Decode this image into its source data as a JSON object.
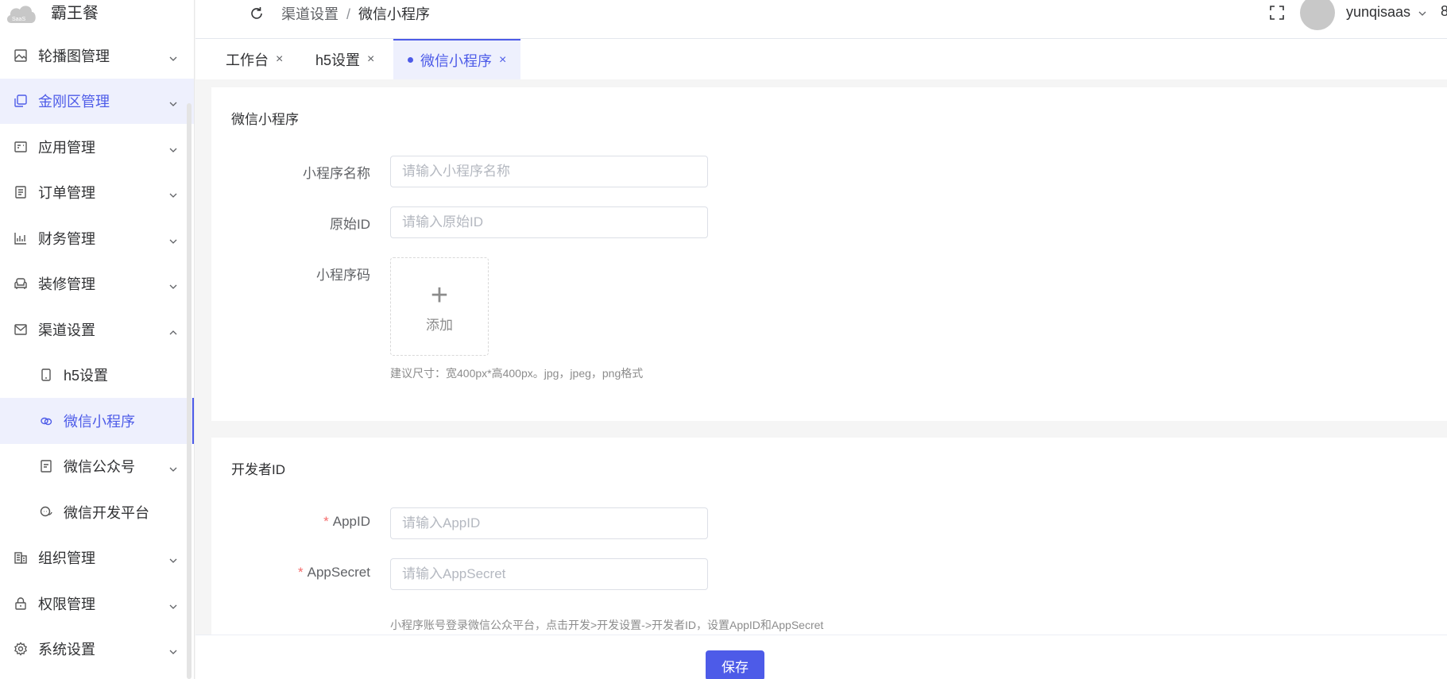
{
  "app": {
    "logo_badge": "SaaS",
    "name": "霸王餐"
  },
  "sidebar": {
    "items": [
      {
        "label": "轮播图管理",
        "icon": "image-icon",
        "expanded": false
      },
      {
        "label": "金刚区管理",
        "icon": "copy-icon",
        "expanded": false,
        "active": true
      },
      {
        "label": "应用管理",
        "icon": "app-card-icon",
        "expanded": false
      },
      {
        "label": "订单管理",
        "icon": "document-icon",
        "expanded": false
      },
      {
        "label": "财务管理",
        "icon": "chart-icon",
        "expanded": false
      },
      {
        "label": "装修管理",
        "icon": "sofa-icon",
        "expanded": false
      },
      {
        "label": "渠道设置",
        "icon": "mail-icon",
        "expanded": true
      },
      {
        "label": "h5设置",
        "icon": "phone-icon",
        "sub": true
      },
      {
        "label": "微信小程序",
        "icon": "chain-icon",
        "sub": true,
        "active": true
      },
      {
        "label": "微信公众号",
        "icon": "doc-icon",
        "sub": true,
        "expandable": true
      },
      {
        "label": "微信开发平台",
        "icon": "chat-icon",
        "sub": true
      },
      {
        "label": "组织管理",
        "icon": "building-icon",
        "expanded": false
      },
      {
        "label": "权限管理",
        "icon": "lock-icon",
        "expanded": false
      },
      {
        "label": "系统设置",
        "icon": "gear-icon",
        "expanded": false
      }
    ]
  },
  "header": {
    "breadcrumb": [
      "渠道设置",
      "微信小程序"
    ],
    "breadcrumb_sep": "/",
    "username": "yunqisaas",
    "edge_glyph": "8"
  },
  "tabs": [
    {
      "label": "工作台",
      "active": false
    },
    {
      "label": "h5设置",
      "active": false
    },
    {
      "label": "微信小程序",
      "active": true
    }
  ],
  "tab_close": "×",
  "section1": {
    "title": "微信小程序",
    "name_label": "小程序名称",
    "name_placeholder": "请输入小程序名称",
    "id_label": "原始ID",
    "id_placeholder": "请输入原始ID",
    "code_label": "小程序码",
    "upload_plus": "+",
    "upload_label": "添加",
    "hint": "建议尺寸：宽400px*高400px。jpg，jpeg，png格式"
  },
  "section2": {
    "title": "开发者ID",
    "required_mark": "*",
    "appid_label": "AppID",
    "appid_placeholder": "请输入AppID",
    "secret_label": "AppSecret",
    "secret_placeholder": "请输入AppSecret",
    "hint": "小程序账号登录微信公众平台，点击开发>开发设置->开发者ID，设置AppID和AppSecret"
  },
  "footer": {
    "save_label": "保存"
  },
  "colors": {
    "accent": "#4d5be8",
    "required": "#f56c6c"
  }
}
